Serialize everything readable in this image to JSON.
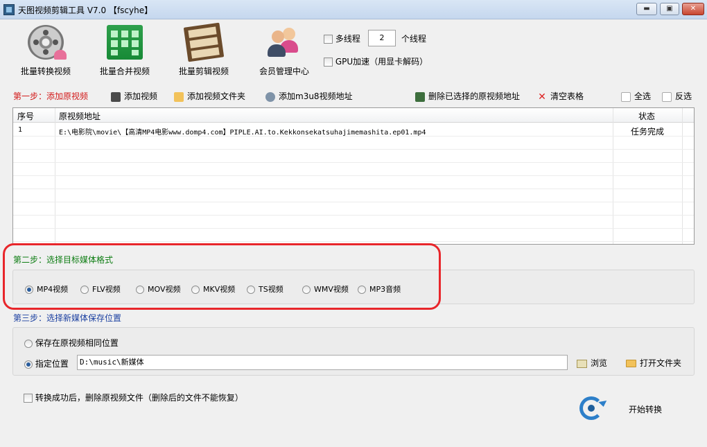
{
  "window": {
    "title": "天图视频剪辑工具 V7.0 【fscyhe】",
    "min_label": "▬",
    "max_label": "▣",
    "close_label": "✕"
  },
  "toolbar": {
    "tools": [
      {
        "label": "批量转换视频",
        "icon": "film-reel-icon"
      },
      {
        "label": "批量合并视频",
        "icon": "merge-grid-icon"
      },
      {
        "label": "批量剪辑视频",
        "icon": "film-strip-icon"
      },
      {
        "label": "会员管理中心",
        "icon": "members-icon"
      }
    ],
    "multithread_label": "多线程",
    "thread_count": "2",
    "thread_suffix": "个线程",
    "gpu_label": "GPU加速（用显卡解码）"
  },
  "step1": {
    "title": "第一步：添加原视频",
    "add_video": "添加视频",
    "add_folder": "添加视频文件夹",
    "add_m3u8": "添加m3u8视频地址",
    "delete_selected": "删除已选择的原视频地址",
    "clear_table": "清空表格",
    "select_all": "全选",
    "invert": "反选"
  },
  "table": {
    "headers": {
      "index": "序号",
      "path": "原视频地址",
      "status": "状态"
    },
    "rows": [
      {
        "index": "1",
        "path": "E:\\电影院\\movie\\【高清MP4电影www.domp4.com】PIPLE.AI.to.Kekkonsekatsuhajimemashita.ep01.mp4",
        "status": "任务完成"
      }
    ]
  },
  "step2": {
    "title": "第二步：选择目标媒体格式",
    "formats": [
      "MP4视频",
      "FLV视频",
      "MOV视频",
      "MKV视频",
      "TS视频",
      "WMV视频",
      "MP3音频"
    ],
    "selected": "MP4视频"
  },
  "step3": {
    "title": "第三步：选择新媒体保存位置",
    "same_location": "保存在原视频相同位置",
    "custom_location": "指定位置",
    "path": "D:\\music\\新媒体",
    "browse": "浏览",
    "open_folder": "打开文件夹"
  },
  "footer": {
    "delete_after": "转换成功后，删除原视频文件（删除后的文件不能恢复）",
    "start": "开始转换"
  }
}
